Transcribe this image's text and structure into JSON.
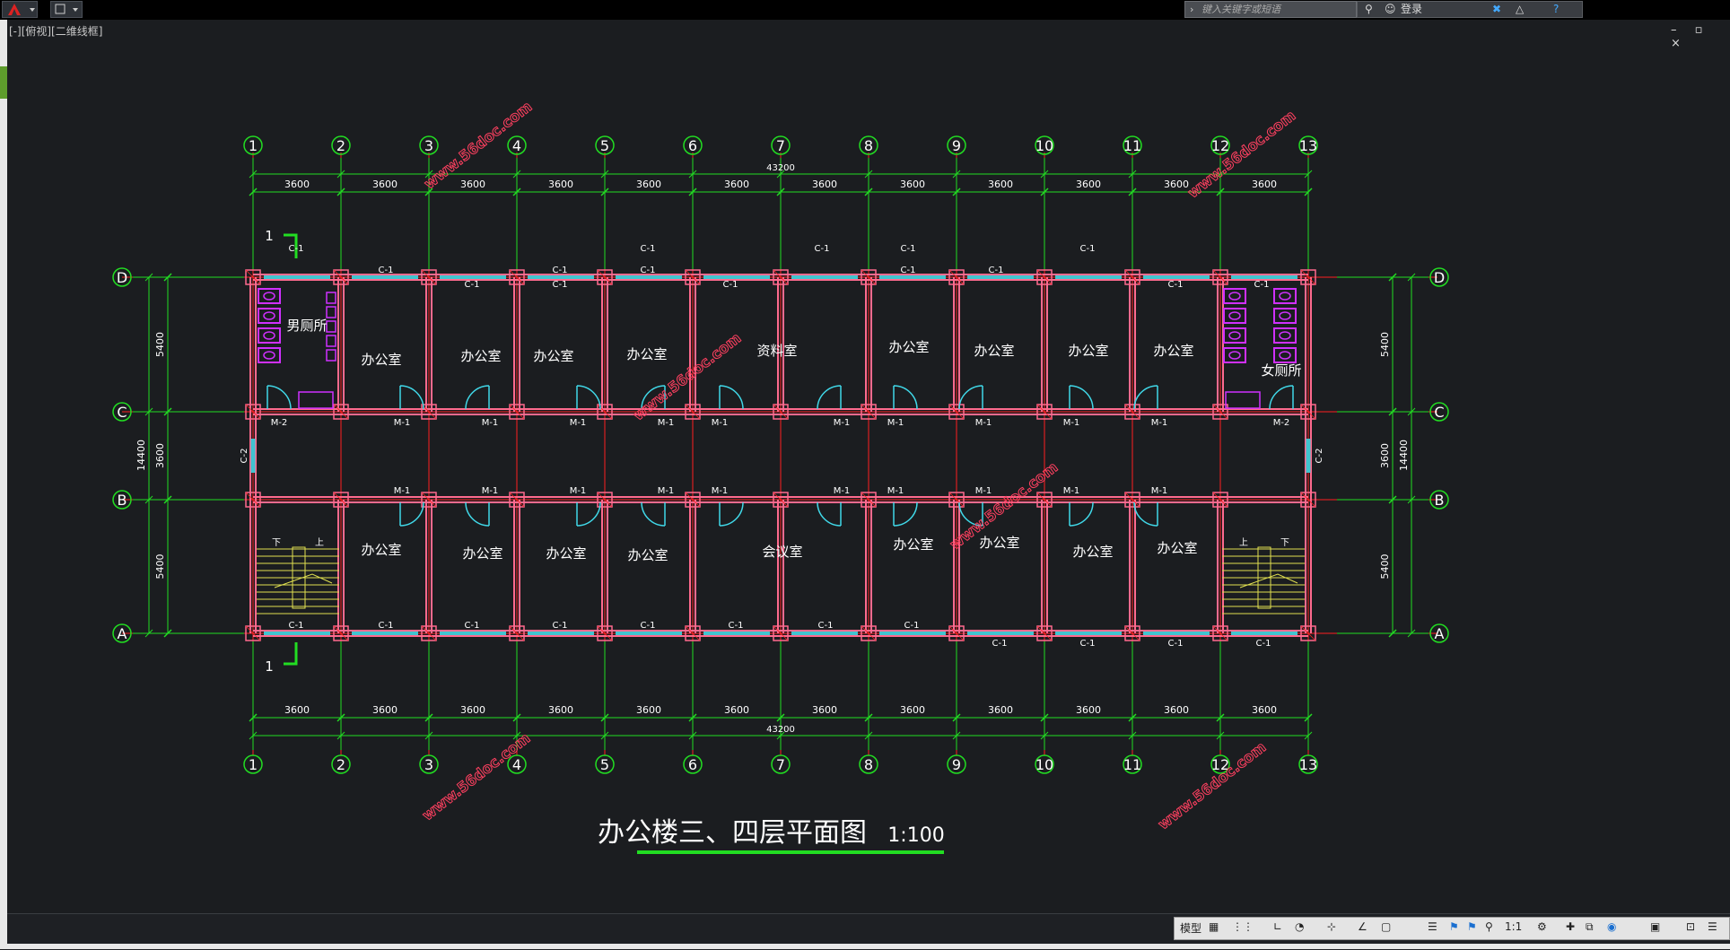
{
  "toolbar": {
    "search_placeholder": "键入关键字或短语",
    "login_label": "登录",
    "window_controls": "– ▫ ×"
  },
  "viewport": {
    "label": "[-][俯视][二维线框]"
  },
  "plan": {
    "colors": {
      "grid_line": "#ff2020",
      "dimension": "#22dd22",
      "wall": "#ff6a8e",
      "window": "#40c4d0",
      "door": "#40d8e8",
      "fixture": "#d030ff",
      "stair": "#e0e050",
      "text": "#ffffff",
      "watermark": "#ff4060"
    },
    "axis_numbers": [
      "1",
      "2",
      "3",
      "4",
      "5",
      "6",
      "7",
      "8",
      "9",
      "10",
      "11",
      "12",
      "13"
    ],
    "axis_letters": [
      "D",
      "C",
      "B",
      "A"
    ],
    "bay_dims": [
      "3600",
      "3600",
      "3600",
      "3600",
      "3600",
      "3600",
      "3600",
      "3600",
      "3600",
      "3600",
      "3600",
      "3600"
    ],
    "total_length": "43200",
    "vertical_dims": [
      "5400",
      "3600",
      "5400"
    ],
    "total_width": "14400",
    "section_mark": "1",
    "door_m1": "M-1",
    "door_m2": "M-2",
    "window_c1": "C-1",
    "window_c2": "C-2",
    "stair_up": "上",
    "stair_down": "下",
    "rooms": {
      "mens_wc": "男厕所",
      "womens_wc": "女厕所",
      "office": "办公室",
      "archive": "资料室",
      "meeting": "会议室"
    },
    "watermark": "www.56doc.com",
    "title": "办公楼三、四层平面图",
    "scale": "1:100"
  },
  "statusbar": {
    "model_tab": "模型",
    "annotation_scale": "1:1"
  }
}
